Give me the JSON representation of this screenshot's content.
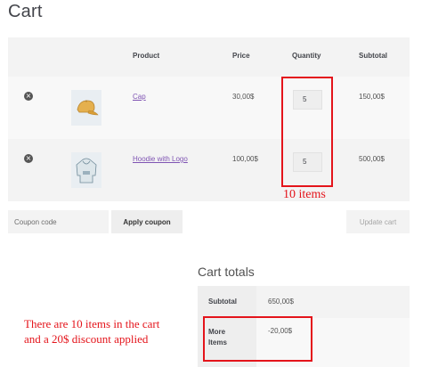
{
  "page": {
    "title": "Cart"
  },
  "cart": {
    "headers": {
      "product": "Product",
      "price": "Price",
      "quantity": "Quantity",
      "subtotal": "Subtotal"
    },
    "items": [
      {
        "name": "Cap",
        "price": "30,00$",
        "quantity": "5",
        "subtotal": "150,00$",
        "image_icon": "cap-icon"
      },
      {
        "name": "Hoodie with Logo",
        "price": "100,00$",
        "quantity": "5",
        "subtotal": "500,00$",
        "image_icon": "hoodie-icon"
      }
    ],
    "remove_glyph": "×"
  },
  "coupon": {
    "placeholder": "Coupon code",
    "apply_label": "Apply coupon",
    "update_label": "Update cart"
  },
  "totals": {
    "title": "Cart totals",
    "subtotal_label": "Subtotal",
    "subtotal_value": "650,00$",
    "discount_label": "More Items",
    "discount_value": "-20,00$"
  },
  "annotations": {
    "quantity_note": "10 items",
    "discount_note_line1": "There are 10 items in the cart",
    "discount_note_line2": "and a 20$ discount applied",
    "color": "#e4141b"
  },
  "colors": {
    "link": "#7f54b3",
    "heading": "#43454b",
    "table_bg": "#f8f8f8"
  }
}
